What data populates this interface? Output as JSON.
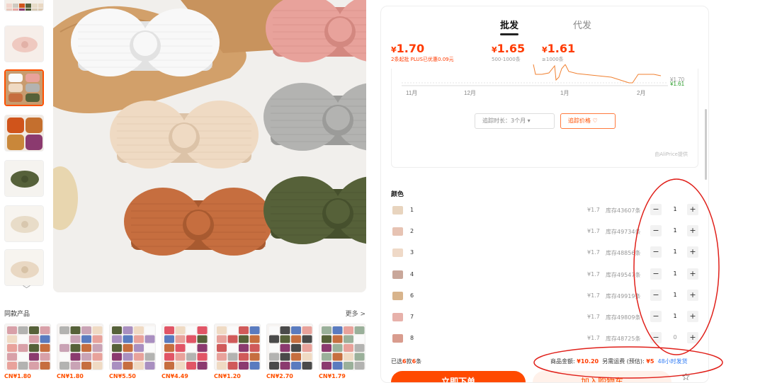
{
  "gallery": {
    "thumb_colors": [
      [
        "#f2d5cc",
        "#e9c9bd"
      ],
      [
        "#cfc9c0",
        "#e9a9a3"
      ],
      [
        "#d0541b",
        "#8b3a6f"
      ],
      [
        "#56613a",
        "#4d5a33"
      ],
      [
        "#e8dcc8",
        "#d9cbb5"
      ],
      [
        "#e9d8c3",
        "#dbc9b0"
      ]
    ],
    "bows": [
      {
        "name": "white-headband",
        "color": "#f8f8f8",
        "shade": "#e2e2e2"
      },
      {
        "name": "pink-headband",
        "color": "#e8a29b",
        "shade": "#d38880"
      },
      {
        "name": "beige-headband",
        "color": "#efdac3",
        "shade": "#dcc3a8"
      },
      {
        "name": "grey-headband",
        "color": "#b3b3b1",
        "shade": "#9b9b99"
      },
      {
        "name": "rust-headband",
        "color": "#c66e3f",
        "shade": "#a85a30"
      },
      {
        "name": "olive-headband",
        "color": "#566139",
        "shade": "#46502d"
      }
    ]
  },
  "similar": {
    "title": "同款产品",
    "more_label": "更多 >",
    "items": [
      {
        "price": "CN¥1.80",
        "accent": "#d8a0a8"
      },
      {
        "price": "CN¥1.80",
        "accent": "#c9a3b5"
      },
      {
        "price": "CN¥5.50",
        "accent": "#a98fc0"
      },
      {
        "price": "CN¥4.49",
        "accent": "#e15566"
      },
      {
        "price": "CN¥1.20",
        "accent": "#d05a5a"
      },
      {
        "price": "CN¥2.70",
        "accent": "#4a4a4a"
      },
      {
        "price": "CN¥1.79",
        "accent": "#9ab09a"
      }
    ]
  },
  "tabs": {
    "wholesale": "批发",
    "dropship": "代发"
  },
  "tiers": [
    {
      "price": "1.70",
      "qty": "2条起批 PLUS已优惠0.09元",
      "highlight": true
    },
    {
      "price": "1.65",
      "qty": "500-1000条",
      "highlight": false
    },
    {
      "price": "1.61",
      "qty": "≥1000条",
      "highlight": false
    }
  ],
  "chart": {
    "x_labels": [
      "11月",
      "12月",
      "1月",
      "2月"
    ],
    "price_high": "¥1.70",
    "price_low": "¥1.61",
    "track_time": "追踪时长：3个月 ▾",
    "track_button": "追踪价格 ♡",
    "provider": "由AliPrice提供"
  },
  "colors_section": {
    "title": "颜色",
    "rows": [
      {
        "name": "1",
        "price": "¥1.7",
        "stock": "库存43607条",
        "qty": "1",
        "swatch": "#e8d4be"
      },
      {
        "name": "2",
        "price": "¥1.7",
        "stock": "库存49734条",
        "qty": "1",
        "swatch": "#e7c3b3"
      },
      {
        "name": "3",
        "price": "¥1.7",
        "stock": "库存48856条",
        "qty": "1",
        "swatch": "#efd9c7"
      },
      {
        "name": "4",
        "price": "¥1.7",
        "stock": "库存49547条",
        "qty": "1",
        "swatch": "#c9a79a"
      },
      {
        "name": "6",
        "price": "¥1.7",
        "stock": "库存49919条",
        "qty": "1",
        "swatch": "#d8b48c"
      },
      {
        "name": "7",
        "price": "¥1.7",
        "stock": "库存49809条",
        "qty": "1",
        "swatch": "#e7b1aa"
      },
      {
        "name": "8",
        "price": "¥1.7",
        "stock": "库存48725条",
        "qty": "0",
        "swatch": "#d99c8e"
      }
    ]
  },
  "summary": {
    "prefix": "已选",
    "count": "6",
    "mid": "款",
    "count2": "6",
    "suffix": "条",
    "amount_label": "商品金额:",
    "amount": "¥10.20",
    "shipping_label": "另需运费 (预估):",
    "shipping": "¥5",
    "ship_time": "48小时发货"
  },
  "actions": {
    "order": "立即下单",
    "cart": "加入购物车"
  },
  "annotation_color": "#e0201a"
}
